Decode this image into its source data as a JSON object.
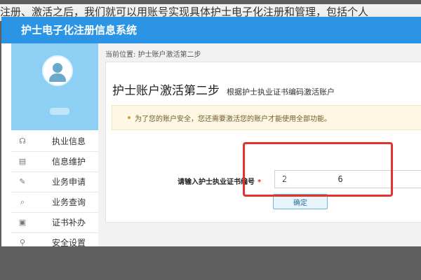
{
  "caption": "注册、激活之后，我们就可以用账号实现具体护士电子化注册和管理，包括个人",
  "app": {
    "title": "护士电子化注册信息系统"
  },
  "profile": {
    "name": ""
  },
  "sidebar": {
    "items": [
      {
        "label": "执业信息",
        "icon": "user-info-icon"
      },
      {
        "label": "信息维护",
        "icon": "id-card-icon"
      },
      {
        "label": "业务申请",
        "icon": "edit-form-icon"
      },
      {
        "label": "业务查询",
        "icon": "search-document-icon"
      },
      {
        "label": "证书补办",
        "icon": "certificate-icon"
      },
      {
        "label": "安全设置",
        "icon": "lock-icon"
      }
    ]
  },
  "breadcrumb": "当前位置: 护士账户激活第二步",
  "page": {
    "title": "护士账户激活第二步",
    "subtitle": "根据护士执业证书编码激活账户"
  },
  "notice": "为了您的账户安全，您还需要激活您的账户才能使用全部功能。",
  "form": {
    "label": "请输入护士执业证书编号",
    "required_mark": "*",
    "value": "2          6",
    "confirm_label": "确定"
  },
  "colors": {
    "header": "#2c94e5",
    "profile_bg": "#8ed0f3",
    "highlight": "#e0332e"
  }
}
